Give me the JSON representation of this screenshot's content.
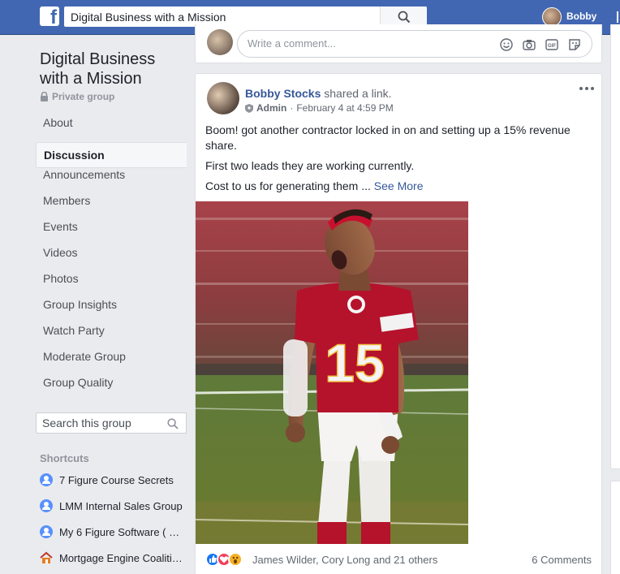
{
  "topbar": {
    "search_value": "Digital Business with a Mission",
    "user_name": "Bobby"
  },
  "sidebar": {
    "group_title": "Digital Business with a Mission",
    "privacy": "Private group",
    "nav": [
      {
        "label": "About",
        "active": false
      },
      {
        "label": "Discussion",
        "active": true
      },
      {
        "label": "Announcements",
        "active": false
      },
      {
        "label": "Members",
        "active": false
      },
      {
        "label": "Events",
        "active": false
      },
      {
        "label": "Videos",
        "active": false
      },
      {
        "label": "Photos",
        "active": false
      },
      {
        "label": "Group Insights",
        "active": false
      },
      {
        "label": "Watch Party",
        "active": false
      },
      {
        "label": "Moderate Group",
        "active": false
      },
      {
        "label": "Group Quality",
        "active": false
      }
    ],
    "search_placeholder": "Search this group",
    "shortcuts_heading": "Shortcuts",
    "shortcuts": [
      {
        "label": "7 Figure Course Secrets",
        "icon": "group-icon"
      },
      {
        "label": "LMM Internal Sales Group",
        "icon": "group-icon"
      },
      {
        "label": "My 6 Figure Software ( …",
        "icon": "group-icon"
      },
      {
        "label": "Mortgage Engine Coaliti…",
        "icon": "home-icon"
      }
    ]
  },
  "comment_box": {
    "placeholder": "Write a comment..."
  },
  "post": {
    "author": "Bobby Stocks",
    "action": " shared a link.",
    "role": "Admin",
    "timestamp": "February 4 at 4:59 PM",
    "paragraphs": [
      "Boom! got another contractor locked in on and setting up a 15% revenue share.",
      "First two leads they are working currently."
    ],
    "last_line": "Cost to us for generating them ... ",
    "see_more": "See More",
    "image_jersey_number": "15",
    "reactions_names": "James Wilder, Cory Long and 21 others",
    "comments_count": "6 Comments"
  },
  "colors": {
    "brand_blue": "#4267b2",
    "link_blue": "#365899",
    "jersey_red": "#b5122c"
  }
}
